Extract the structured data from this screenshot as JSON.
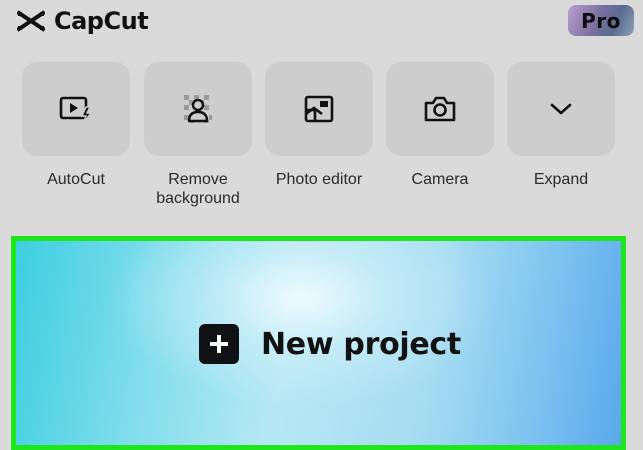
{
  "app": {
    "name": "CapCut",
    "pro_badge": "Pro"
  },
  "tools": [
    {
      "label": "AutoCut",
      "icon": "autocut-icon"
    },
    {
      "label": "Remove\nbackground",
      "icon": "remove-background-icon"
    },
    {
      "label": "Photo editor",
      "icon": "photo-editor-icon"
    },
    {
      "label": "Camera",
      "icon": "camera-icon"
    },
    {
      "label": "Expand",
      "icon": "chevron-down-icon"
    }
  ],
  "new_project": {
    "label": "New project",
    "icon": "plus-icon",
    "highlight_color": "#1ee61a"
  }
}
